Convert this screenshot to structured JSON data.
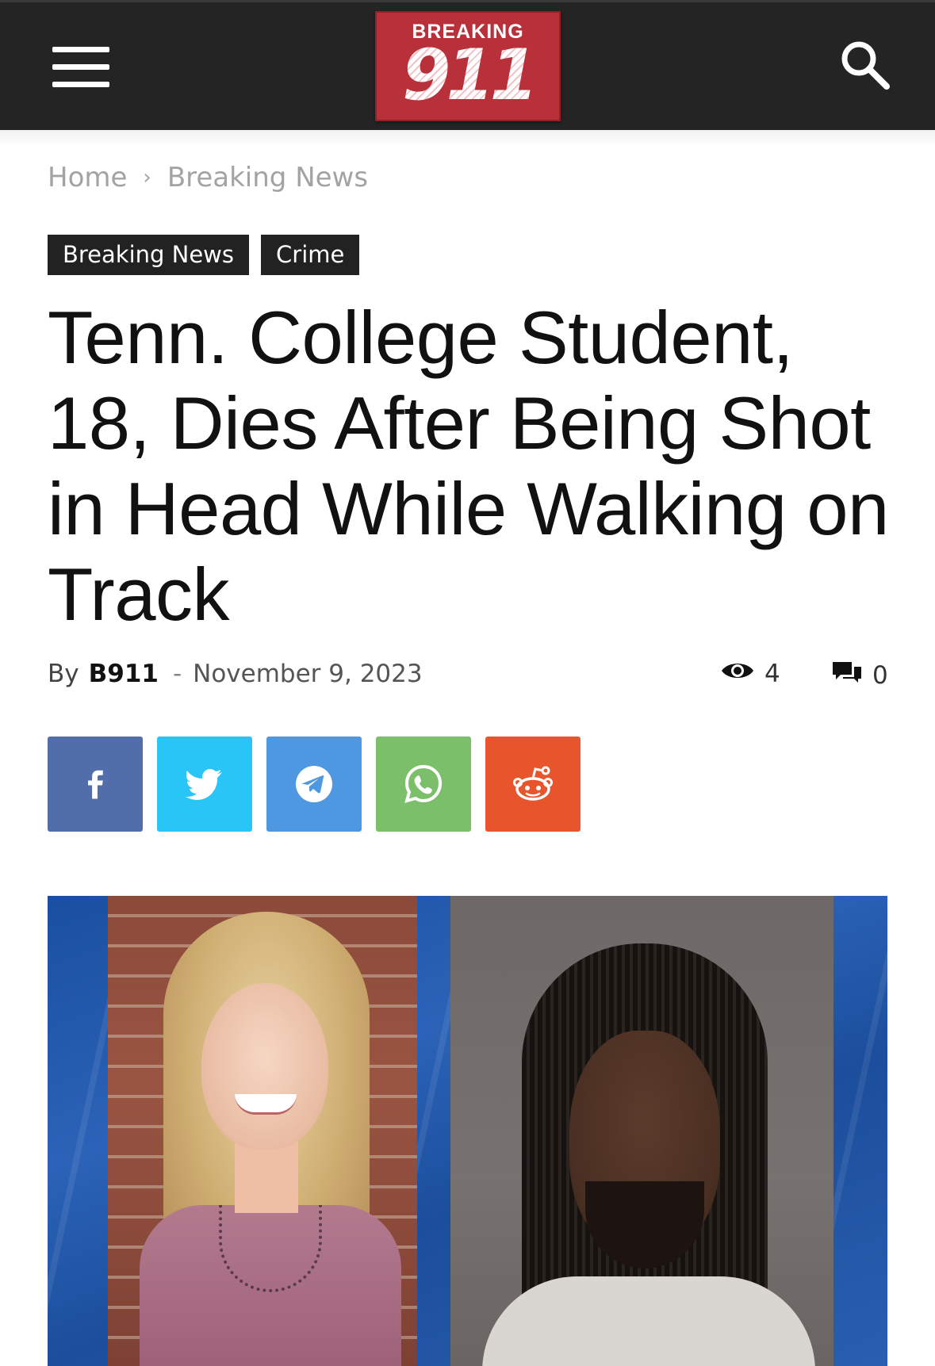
{
  "header": {
    "menu_icon": "hamburger-menu-icon",
    "logo_top_text": "BREAKING",
    "logo_number": "911",
    "search_icon": "search-icon",
    "bar_color": "#242424",
    "logo_color": "#b8313a"
  },
  "breadcrumb": {
    "items": [
      "Home",
      "Breaking News"
    ],
    "separator": "›"
  },
  "categories": [
    "Breaking News",
    "Crime"
  ],
  "article": {
    "title": "Tenn. College Student, 18, Dies After Being Shot in Head While Walking on Track",
    "by_label": "By",
    "author": "B911",
    "separator": "-",
    "date": "November 9, 2023",
    "views": "4",
    "comments": "0",
    "views_icon": "eye-icon",
    "comments_icon": "comments-icon"
  },
  "share_buttons": [
    {
      "name": "facebook",
      "icon": "facebook-icon",
      "color": "#516eab"
    },
    {
      "name": "twitter",
      "icon": "twitter-icon",
      "color": "#29c5f6"
    },
    {
      "name": "telegram",
      "icon": "telegram-icon",
      "color": "#179cde"
    },
    {
      "name": "whatsapp",
      "icon": "whatsapp-icon",
      "color": "#7bbf6a"
    },
    {
      "name": "reddit",
      "icon": "reddit-icon",
      "color": "#f54200"
    }
  ],
  "featured_image": {
    "left_subject": "photo of smiling young woman",
    "right_subject": "mugshot of man"
  }
}
